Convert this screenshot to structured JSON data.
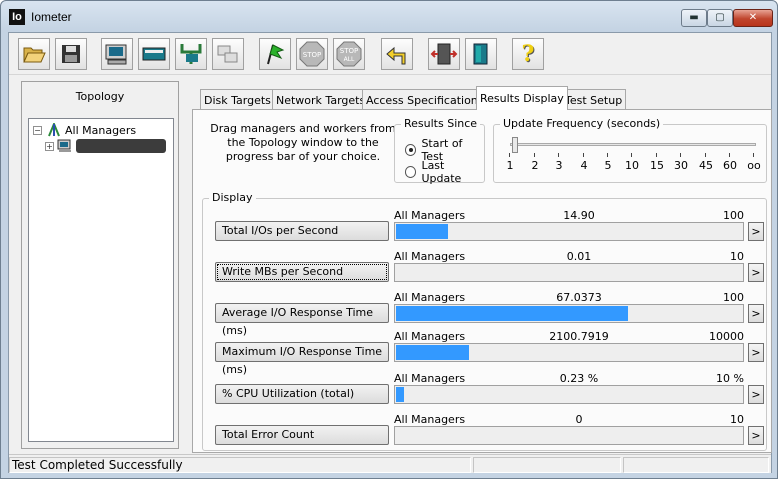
{
  "window": {
    "title": "Iometer",
    "icon_text": "Io",
    "minimize": "▬",
    "maximize": "▢",
    "close": "✕"
  },
  "toolbar": {
    "buttons": [
      {
        "name": "open-config-button",
        "icon": "folder-open-icon"
      },
      {
        "name": "save-config-button",
        "icon": "floppy-disk-icon"
      },
      {
        "name": "start-disk-worker-button",
        "icon": "disk-worker-icon"
      },
      {
        "name": "start-network-worker-button",
        "icon": "network-worker-icon"
      },
      {
        "name": "new-manager-button",
        "icon": "manager-icon"
      },
      {
        "name": "duplicate-worker-button",
        "icon": "duplicate-worker-icon"
      },
      {
        "name": "start-tests-button",
        "icon": "green-flag-icon"
      },
      {
        "name": "stop-button",
        "icon": "stop-sign-icon",
        "label": "STOP"
      },
      {
        "name": "stop-all-button",
        "icon": "stop-all-icon",
        "label": "STOP",
        "sublabel": "ALL"
      },
      {
        "name": "reset-workers-button",
        "icon": "reset-arrow-icon"
      },
      {
        "name": "exit-button",
        "icon": "exit-door-icon"
      },
      {
        "name": "about-button",
        "icon": "help-icon",
        "label": "?"
      },
      {
        "name": "disconnect-button",
        "icon": "disconnect-icon"
      }
    ]
  },
  "topology": {
    "title": "Topology",
    "root": "All Managers",
    "expand_symbol_root": "−",
    "expand_symbol_child": "+"
  },
  "tabs": [
    "Disk Targets",
    "Network Targets",
    "Access Specifications",
    "Results Display",
    "Test Setup"
  ],
  "active_tab": "Results Display",
  "results": {
    "instructions": "Drag managers and workers from the Topology window to the progress bar of your choice.",
    "since": {
      "title": "Results Since",
      "options": [
        "Start of Test",
        "Last Update"
      ],
      "selected": "Start of Test"
    },
    "update_frequency": {
      "title": "Update Frequency (seconds)",
      "ticks": [
        "1",
        "2",
        "3",
        "4",
        "5",
        "10",
        "15",
        "30",
        "45",
        "60",
        "oo"
      ],
      "selected_index": 0
    },
    "display_title": "Display",
    "metrics": [
      {
        "button": "Total I/Os per Second",
        "source": "All Managers",
        "value": "14.90",
        "max": "100",
        "fill": 0.149
      },
      {
        "button": "Write MBs per Second",
        "source": "All Managers",
        "value": "0.01",
        "max": "10",
        "fill": 0.001
      },
      {
        "button": "Average I/O Response Time (ms)",
        "source": "All Managers",
        "value": "67.0373",
        "max": "100",
        "fill": 0.67
      },
      {
        "button": "Maximum I/O Response Time (ms)",
        "source": "All Managers",
        "value": "2100.7919",
        "max": "10000",
        "fill": 0.21
      },
      {
        "button": "% CPU Utilization (total)",
        "source": "All Managers",
        "value": "0.23 %",
        "max": "10 %",
        "fill": 0.023
      },
      {
        "button": "Total Error Count",
        "source": "All Managers",
        "value": "0",
        "max": "10",
        "fill": 0.0
      }
    ],
    "arrow": ">"
  },
  "status": {
    "text": "Test Completed Successfully"
  },
  "colors": {
    "bar_fill": "#3399ff",
    "window_frame": "#c4d3e3",
    "close_button": "#c0452d"
  }
}
